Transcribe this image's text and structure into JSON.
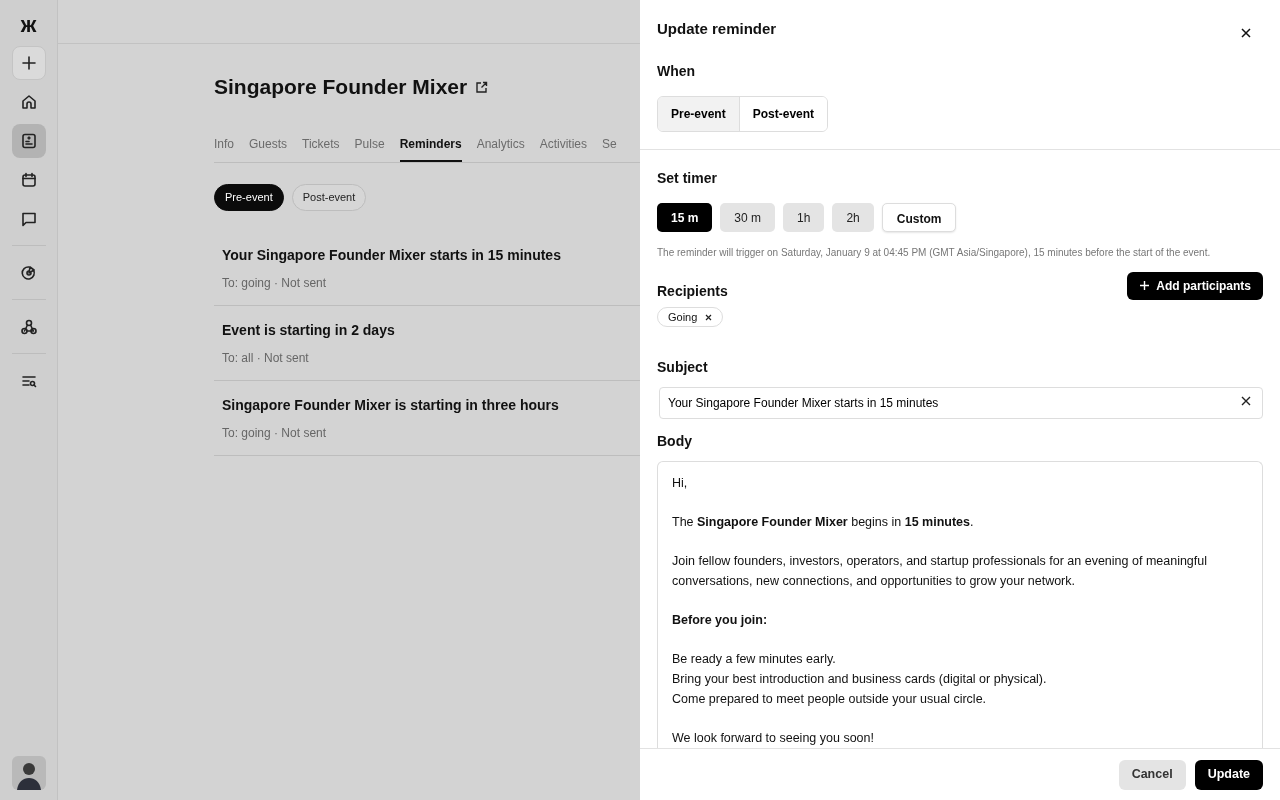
{
  "sidebar": {
    "items": [
      {
        "kind": "logo",
        "text": "ж"
      },
      {
        "kind": "plus",
        "selected": false
      },
      {
        "kind": "home",
        "selected": false
      },
      {
        "kind": "event",
        "selected": true
      },
      {
        "kind": "calendar",
        "selected": false
      },
      {
        "kind": "chat",
        "selected": false
      },
      {
        "kind": "divider"
      },
      {
        "kind": "pulse",
        "selected": false
      },
      {
        "kind": "divider"
      },
      {
        "kind": "webhook",
        "selected": false
      },
      {
        "kind": "divider"
      },
      {
        "kind": "search-list",
        "selected": false
      }
    ]
  },
  "event": {
    "title": "Singapore Founder Mixer"
  },
  "tabs": [
    {
      "label": "Info",
      "selected": false
    },
    {
      "label": "Guests",
      "selected": false
    },
    {
      "label": "Tickets",
      "selected": false
    },
    {
      "label": "Pulse",
      "selected": false
    },
    {
      "label": "Reminders",
      "selected": true
    },
    {
      "label": "Analytics",
      "selected": false
    },
    {
      "label": "Activities",
      "selected": false
    },
    {
      "label": "Se",
      "selected": false
    }
  ],
  "filters": [
    {
      "label": "Pre-event",
      "selected": true
    },
    {
      "label": "Post-event",
      "selected": false
    }
  ],
  "reminders": [
    {
      "title": "Your Singapore Founder Mixer starts in 15 minutes",
      "meta": "To: going · Not sent"
    },
    {
      "title": "Event is starting in 2 days",
      "meta": "To: all · Not sent"
    },
    {
      "title": "Singapore Founder Mixer is starting in three hours",
      "meta": "To: going · Not sent"
    }
  ],
  "drawer": {
    "title": "Update reminder",
    "when": {
      "label": "When",
      "options": [
        {
          "label": "Pre-event",
          "selected": true
        },
        {
          "label": "Post-event",
          "selected": false
        }
      ]
    },
    "timer": {
      "label": "Set timer",
      "options": [
        {
          "label": "15 m",
          "kind": "preset",
          "selected": true
        },
        {
          "label": "30 m",
          "kind": "preset",
          "selected": false
        },
        {
          "label": "1h",
          "kind": "preset",
          "selected": false
        },
        {
          "label": "2h",
          "kind": "preset",
          "selected": false
        },
        {
          "label": "Custom",
          "kind": "custom",
          "selected": false
        }
      ],
      "hint": "The reminder will trigger on Saturday, January 9 at 04:45 PM (GMT Asia/Singapore), 15 minutes before the start of the event."
    },
    "recipients": {
      "label": "Recipients",
      "add_button": "Add participants",
      "chips": [
        "Going"
      ]
    },
    "subject": {
      "label": "Subject",
      "value": "Your Singapore Founder Mixer starts in 15 minutes"
    },
    "body": {
      "label": "Body",
      "paragraphs": [
        {
          "kind": "text",
          "lines": [
            "Hi,"
          ]
        },
        {
          "kind": "text",
          "lines": [
            "The **Singapore Founder Mixer** begins in **15 minutes**."
          ]
        },
        {
          "kind": "text",
          "lines": [
            "Join fellow founders, investors, operators, and startup professionals for an evening of meaningful conversations, new connections, and opportunities to grow your network."
          ]
        },
        {
          "kind": "heading",
          "lines": [
            "Before you join:"
          ]
        },
        {
          "kind": "text",
          "lines": [
            "Be ready a few minutes early.",
            "Bring your best introduction and business cards (digital or physical).",
            "Come prepared to meet people outside your usual circle."
          ]
        },
        {
          "kind": "text",
          "lines": [
            "We look forward to seeing you soon!"
          ]
        }
      ]
    },
    "buttons": [
      {
        "label": "Cancel",
        "kind": "secondary"
      },
      {
        "label": "Update",
        "kind": "primary"
      }
    ]
  }
}
